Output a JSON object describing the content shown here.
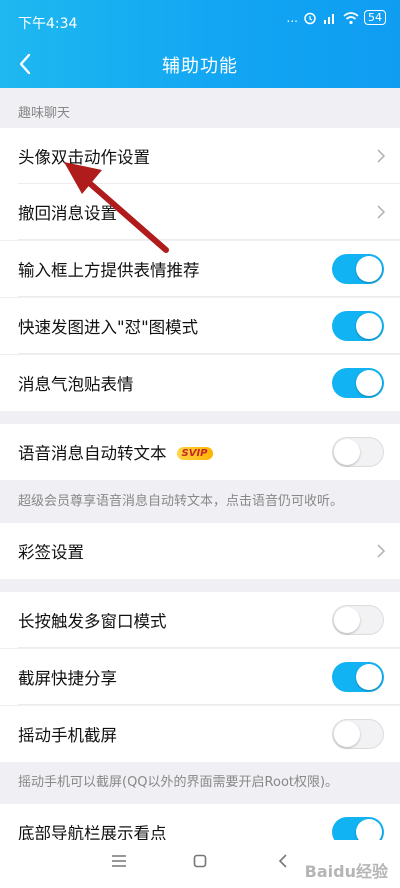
{
  "status": {
    "time": "下午4:34",
    "dots": "...",
    "battery": "54"
  },
  "nav": {
    "title": "辅助功能"
  },
  "section1": {
    "label": "趣味聊天"
  },
  "rows": [
    {
      "label": "头像双击动作设置",
      "type": "link"
    },
    {
      "label": "撤回消息设置",
      "type": "link"
    },
    {
      "label": "输入框上方提供表情推荐",
      "type": "toggle",
      "on": true
    },
    {
      "label": "快速发图进入\"怼\"图模式",
      "type": "toggle",
      "on": true
    },
    {
      "label": "消息气泡贴表情",
      "type": "toggle",
      "on": true
    },
    {
      "label": "语音消息自动转文本",
      "type": "toggle",
      "on": false,
      "badge": "SVIP"
    },
    {
      "label": "彩签设置",
      "type": "link"
    },
    {
      "label": "长按触发多窗口模式",
      "type": "toggle",
      "on": false
    },
    {
      "label": "截屏快捷分享",
      "type": "toggle",
      "on": true
    },
    {
      "label": "摇动手机截屏",
      "type": "toggle",
      "on": false
    },
    {
      "label": "底部导航栏展示看点",
      "type": "toggle",
      "on": true
    }
  ],
  "notes": {
    "voice": "超级会员尊享语音消息自动转文本，点击语音仍可收听。",
    "shake": "摇动手机可以截屏(QQ以外的界面需要开启Root权限)。"
  },
  "watermark": "Baidu经验",
  "colors": {
    "accent": "#12b3f2",
    "arrow": "#b01c1c"
  }
}
